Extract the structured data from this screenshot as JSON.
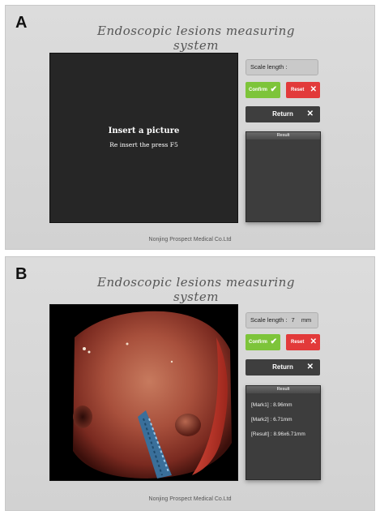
{
  "panels": [
    {
      "letter": "A",
      "app_title": "Endoscopic lesions measuring system",
      "display": {
        "insert_title": "Insert a picture",
        "insert_sub": "Re insert the press F5"
      },
      "scale_label": "Scale length :",
      "confirm_label": "Confirm",
      "reset_label": "Reset",
      "return_label": "Return",
      "result_title": "Result",
      "footer": "Nonjing Prospect Medical Co.Ltd"
    },
    {
      "letter": "B",
      "app_title": "Endoscopic lesions measuring system",
      "scale_label": "Scale length :",
      "scale_value": "7",
      "scale_unit": "mm",
      "confirm_label": "Confirm",
      "reset_label": "Reset",
      "return_label": "Return",
      "result_title": "Result",
      "results": [
        "[Mark1] : 8.96mm",
        "[Mark2] : 6.71mm",
        "[Result] : 8.96x6.71mm"
      ],
      "footer": "Nonjing Prospect Medical Co.Ltd"
    }
  ],
  "colors": {
    "confirm": "#7dc43a",
    "reset": "#e23a3a",
    "return": "#3e3e3e",
    "result_bg": "#3d3d3d"
  },
  "icons": {
    "confirm": "check-icon",
    "reset": "close-icon",
    "return": "close-icon"
  }
}
